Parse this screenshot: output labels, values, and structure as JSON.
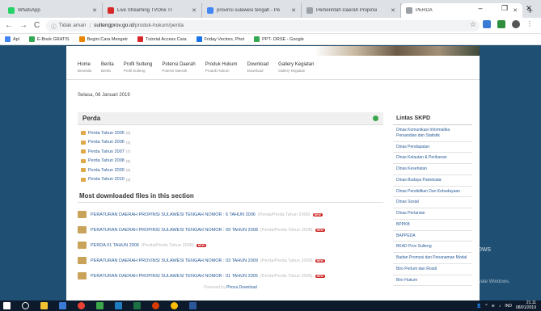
{
  "browser": {
    "tabs": [
      {
        "label": "WhatsApp",
        "color": "#25d366"
      },
      {
        "label": "Live Streaming TVOne Tr",
        "color": "#d62828"
      },
      {
        "label": "provinsi sulawesi tengah - Pe",
        "color": "#4285f4"
      },
      {
        "label": "Pemerintah Daerah Propinsi",
        "color": "#9aa0a6"
      },
      {
        "label": "PERDA",
        "color": "#9aa0a6"
      }
    ],
    "new_tab": "+",
    "window_controls": {
      "minimize": "–",
      "maximize": "❐",
      "close": "✕"
    },
    "nav": {
      "back": "←",
      "forward": "→",
      "reload": "C"
    },
    "security_label": "Tidak aman",
    "url_host": "sultengprov.go.id",
    "url_path": "/produk-hukum/perda",
    "bookmarks": [
      {
        "label": "Apl",
        "color": "#4285f4"
      },
      {
        "label": "E-Book GRATIS",
        "color": "#34a853"
      },
      {
        "label": "Begini Cara Mengetr",
        "color": "#ea8600"
      },
      {
        "label": "Tutorial Access Cara",
        "color": "#d62828"
      },
      {
        "label": "Friday Vectors, Phot",
        "color": "#1a73e8"
      },
      {
        "label": "PPT- DRSE - Google",
        "color": "#34a853"
      }
    ]
  },
  "site": {
    "menu": [
      {
        "title": "Home",
        "sub": "Beranda"
      },
      {
        "title": "Berita",
        "sub": "Berita"
      },
      {
        "title": "Profil Sulteng",
        "sub": "Profil Sulteng"
      },
      {
        "title": "Potensi Daerah",
        "sub": "Potensi Daerah"
      },
      {
        "title": "Produk Hukum",
        "sub": "Produk Hukum"
      },
      {
        "title": "Download",
        "sub": "Download"
      },
      {
        "title": "Gallery Kegiatan",
        "sub": "Gallery Kegiatan"
      }
    ],
    "date": "Selasa, 08 Januari 2019",
    "perda": {
      "title": "Perda",
      "items": [
        {
          "label": "Perda Tahun 2005",
          "count": "(6)"
        },
        {
          "label": "Perda Tahun 2006",
          "count": "(4)"
        },
        {
          "label": "Perda Tahun 2007",
          "count": "(7)"
        },
        {
          "label": "Perda Tahun 2008",
          "count": "(9)"
        },
        {
          "label": "Perda Tahun 2009",
          "count": "(8)"
        },
        {
          "label": "Perda Tahun 2010",
          "count": "(3)"
        }
      ]
    },
    "downloads": {
      "title": "Most downloaded files in this section",
      "new_badge": "NEW",
      "items": [
        {
          "label": "PERATURAN DAERAH PROPINSI SULAWESI TENGAH NOMOR : 6 TAHUN 2006",
          "cat": "(Perda/Perda Tahun 2006)"
        },
        {
          "label": "PERATURAN DAERAH PROPINSI SULAWESI TENGAH NOMOR : 09 TAHUN 2008",
          "cat": "(Perda/Perda Tahun 2008)"
        },
        {
          "label": "PERDA 01 TAHUN 2006",
          "cat": "(Perda/Perda Tahun 2006)"
        },
        {
          "label": "PERATURAN DAERAH PROVINSI SULAWESI TENGAH NOMOR : 03 TAHUN 2009",
          "cat": "(Perda/Perda Tahun 2009)"
        },
        {
          "label": "PERATURAN DAERAH PROPINSI SULAWESI TENGAH NOMOR : 01 TAHUN 2005",
          "cat": "(Perda/Perda Tahun 2005)"
        }
      ],
      "powered_prefix": "Powered by",
      "powered_name": "Phoca Download"
    },
    "side": {
      "title": "Lintas SKPD",
      "items": [
        "Dinas Komunikasi Informatika Persandian dan Statistik",
        "Dinas Pendapatan",
        "Dinas Kelautan & Perikanan",
        "Dinas Kesehatan",
        "Dinas Budaya Pariwisata",
        "Dinas Pendidikan Dan Kebudayaan",
        "Dinas Sosial",
        "Dinas Pertanian",
        "BPPKB",
        "BAPPEDA",
        "BKAD Prov Sulteng",
        "Badan Promosi dan Penanaman Modal",
        "Biro Perlum dan Rosdi",
        "Biro Hukum"
      ]
    }
  },
  "watermark": {
    "line1": "Activate Windows",
    "line2": "Go to Settings to activate Windows."
  },
  "taskbar": {
    "icons": [
      {
        "name": "windows-start-icon",
        "color": "#ffffff"
      },
      {
        "name": "search-icon",
        "color": "#ffffff"
      },
      {
        "name": "file-explorer-icon",
        "color": "#f2c232"
      },
      {
        "name": "app-icon-1",
        "color": "#3a7bd5"
      },
      {
        "name": "chrome-icon",
        "color": "#e94235"
      },
      {
        "name": "app-icon-2",
        "color": "#3ca64a"
      },
      {
        "name": "app-icon-3",
        "color": "#1f7cc1"
      },
      {
        "name": "excel-icon",
        "color": "#1d7044"
      },
      {
        "name": "app-icon-4",
        "color": "#d83b01"
      },
      {
        "name": "chrome-icon-2",
        "color": "#fbbc04"
      },
      {
        "name": "word-icon",
        "color": "#2b579a"
      }
    ],
    "lang": "IND",
    "time": "21.11",
    "date": "08/01/2019"
  }
}
